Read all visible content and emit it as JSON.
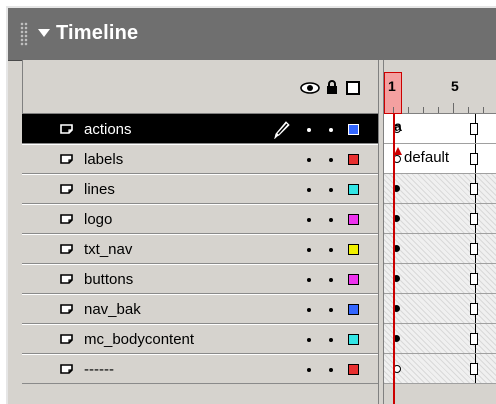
{
  "panel": {
    "title": "Timeline"
  },
  "header": {
    "icons": [
      "eye-icon",
      "lock-icon",
      "outline-icon"
    ]
  },
  "frames": {
    "ruler_labels": [
      "1",
      "5"
    ],
    "current_frame": "1"
  },
  "layers": [
    {
      "name": "actions",
      "selected": true,
      "color": "#3366ff",
      "frame_marker": "a",
      "keyframe": "hollow"
    },
    {
      "name": "labels",
      "selected": false,
      "color": "#e83030",
      "frame_label": "default",
      "keyframe": "hollow"
    },
    {
      "name": "lines",
      "selected": false,
      "color": "#33e5e5",
      "keyframe": "filled"
    },
    {
      "name": "logo",
      "selected": false,
      "color": "#ee33ee",
      "keyframe": "filled"
    },
    {
      "name": "txt_nav",
      "selected": false,
      "color": "#f0f000",
      "keyframe": "filled"
    },
    {
      "name": "buttons",
      "selected": false,
      "color": "#ee33ee",
      "keyframe": "filled"
    },
    {
      "name": "nav_bak",
      "selected": false,
      "color": "#3366ff",
      "keyframe": "filled"
    },
    {
      "name": "mc_bodycontent",
      "selected": false,
      "color": "#33e5e5",
      "keyframe": "filled"
    },
    {
      "name": "------",
      "selected": false,
      "color": "#e83030",
      "keyframe": "hollow"
    }
  ],
  "colors": {
    "titlebar": "#6f6f6f",
    "panel_bg": "#d6d3ce",
    "selection": "#000000",
    "playhead": "#cc0000"
  }
}
